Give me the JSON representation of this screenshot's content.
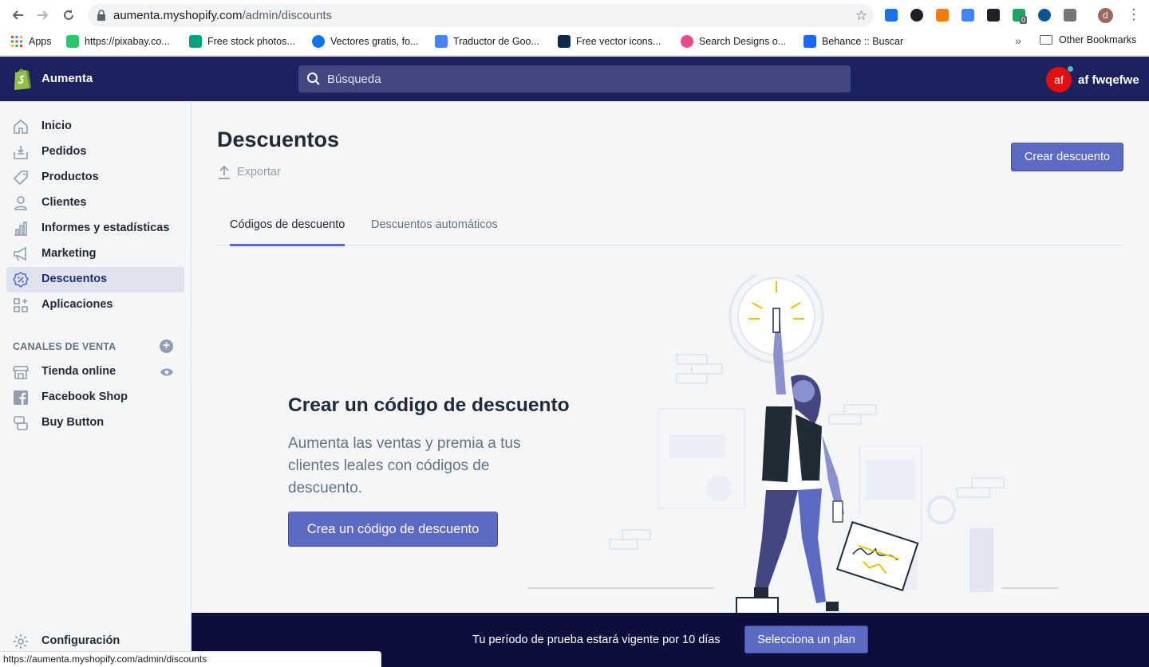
{
  "browser": {
    "url_host": "aumenta.myshopify.com",
    "url_path": "/admin/discounts",
    "profile_initial": "d",
    "bookmarks": [
      {
        "label": "Apps",
        "icon": "apps-grid-icon",
        "color": "#4285f4"
      },
      {
        "label": "https://pixabay.co...",
        "icon": "pixabay-icon",
        "color": "#2ec66d"
      },
      {
        "label": "Free stock photos...",
        "icon": "pexels-icon",
        "color": "#05a081"
      },
      {
        "label": "Vectores gratis, fo...",
        "icon": "freepik-icon",
        "color": "#1273eb"
      },
      {
        "label": "Traductor de Goo...",
        "icon": "google-translate-icon",
        "color": "#4285f4"
      },
      {
        "label": "Free vector icons...",
        "icon": "flaticon-icon",
        "color": "#0e2a47"
      },
      {
        "label": "Search Designs o...",
        "icon": "dribbble-icon",
        "color": "#ea4c89"
      },
      {
        "label": "Behance :: Buscar",
        "icon": "behance-icon",
        "color": "#1769ff"
      }
    ],
    "more_bookmarks": "»",
    "other_bookmarks": "Other Bookmarks",
    "extension_badge": "0",
    "status_url": "https://aumenta.myshopify.com/admin/discounts"
  },
  "topbar": {
    "store_name": "Aumenta",
    "search_placeholder": "Búsqueda",
    "user_initials": "af",
    "user_name": "af fwqefwe"
  },
  "sidebar": {
    "items": [
      {
        "label": "Inicio",
        "icon": "home-icon"
      },
      {
        "label": "Pedidos",
        "icon": "orders-icon"
      },
      {
        "label": "Productos",
        "icon": "tag-icon"
      },
      {
        "label": "Clientes",
        "icon": "customer-icon"
      },
      {
        "label": "Informes y estadísticas",
        "icon": "analytics-icon"
      },
      {
        "label": "Marketing",
        "icon": "megaphone-icon"
      },
      {
        "label": "Descuentos",
        "icon": "discount-icon",
        "active": true
      },
      {
        "label": "Aplicaciones",
        "icon": "apps-icon"
      }
    ],
    "channels_title": "CANALES DE VENTA",
    "add_channel": "+",
    "channels": [
      {
        "label": "Tienda online",
        "icon": "store-icon"
      },
      {
        "label": "Facebook Shop",
        "icon": "facebook-icon"
      },
      {
        "label": "Buy Button",
        "icon": "buy-button-icon"
      }
    ],
    "settings": {
      "label": "Configuración",
      "icon": "settings-icon"
    }
  },
  "main": {
    "title": "Descuentos",
    "export_label": "Exportar",
    "create_button": "Crear descuento",
    "tabs": [
      {
        "label": "Códigos de descuento",
        "active": true
      },
      {
        "label": "Descuentos automáticos",
        "active": false
      }
    ],
    "empty_state": {
      "heading": "Crear un código de descuento",
      "description": "Aumenta las ventas y premia a tus clientes leales con códigos de descuento.",
      "cta": "Crea un código de descuento"
    }
  },
  "trial_banner": {
    "text": "Tu período de prueba estará vigente por 10 días",
    "button": "Selecciona un plan"
  },
  "colors": {
    "topbar": "#1c2260",
    "accent": "#5c6ac4",
    "banner": "#0d0e3d"
  }
}
